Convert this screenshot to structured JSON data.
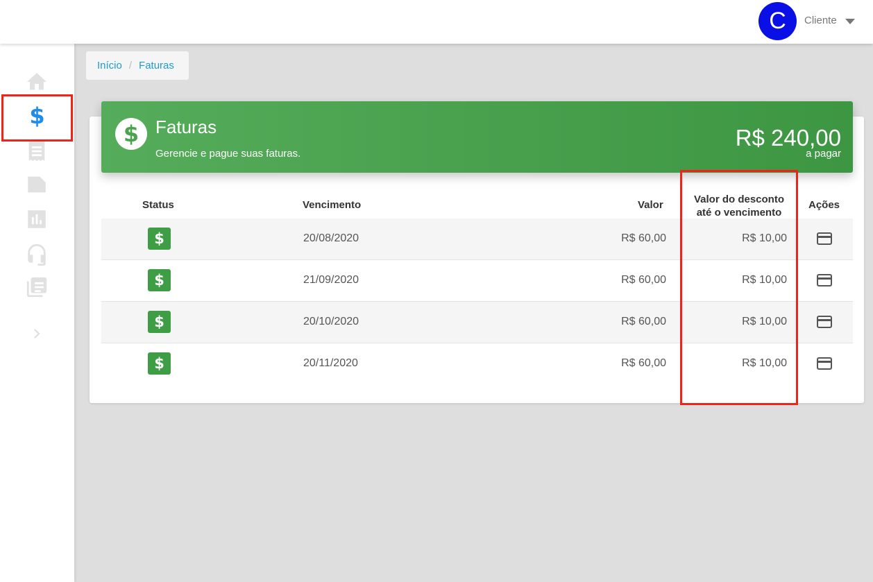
{
  "topbar": {
    "avatar_letter": "C",
    "user_name": "Cliente",
    "caret_icon": "caret-down-icon"
  },
  "sidebar": {
    "items": [
      {
        "name": "home",
        "icon": "home-icon"
      },
      {
        "name": "faturas",
        "icon": "dollar-icon",
        "active": true,
        "glyph": "$"
      },
      {
        "name": "receipt",
        "icon": "receipt-icon"
      },
      {
        "name": "note",
        "icon": "note-icon"
      },
      {
        "name": "reports",
        "icon": "chart-icon"
      },
      {
        "name": "support",
        "icon": "headset-icon"
      },
      {
        "name": "library",
        "icon": "library-icon"
      },
      {
        "name": "expand",
        "icon": "chevron-right-icon"
      }
    ]
  },
  "breadcrumb": {
    "home": "Início",
    "separator": "/",
    "current": "Faturas"
  },
  "header": {
    "icon_glyph": "$",
    "title": "Faturas",
    "subtitle": "Gerencie e pague suas faturas.",
    "amount": "R$ 240,00",
    "amount_label": "a pagar"
  },
  "table": {
    "columns": {
      "status": "Status",
      "due": "Vencimento",
      "value": "Valor",
      "discount_line1": "Valor do desconto",
      "discount_line2": "até o vencimento",
      "actions": "Ações"
    },
    "rows": [
      {
        "status": "$",
        "due": "20/08/2020",
        "value": "R$ 60,00",
        "discount": "R$ 10,00"
      },
      {
        "status": "$",
        "due": "21/09/2020",
        "value": "R$ 60,00",
        "discount": "R$ 10,00"
      },
      {
        "status": "$",
        "due": "20/10/2020",
        "value": "R$ 60,00",
        "discount": "R$ 10,00"
      },
      {
        "status": "$",
        "due": "20/11/2020",
        "value": "R$ 60,00",
        "discount": "R$ 10,00"
      }
    ]
  },
  "colors": {
    "accent_green": "#4aa34f",
    "highlight_red": "#f02318",
    "link_blue": "#1e9dc8",
    "avatar_blue": "#0a0fe6"
  }
}
